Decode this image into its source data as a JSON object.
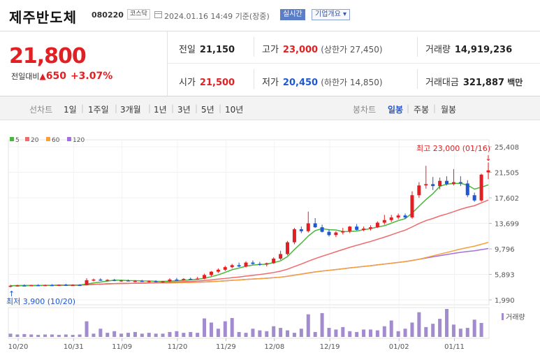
{
  "header": {
    "name": "제주반도체",
    "code": "080220",
    "market": "코스닥",
    "datetime": "2024.01.16 14:49",
    "basis": "기준(장중)",
    "realtime": "실시간",
    "company_info": "기업개요"
  },
  "price": {
    "current": "21,800",
    "change_label": "전일대비",
    "change_arrow": "▲",
    "change": "650",
    "change_pct": "+3.07%"
  },
  "stats": {
    "prev_close": {
      "label": "전일",
      "value": "21,150"
    },
    "high": {
      "label": "고가",
      "value": "23,000",
      "note": "(상한가 27,450)"
    },
    "volume": {
      "label": "거래량",
      "value": "14,919,236"
    },
    "open": {
      "label": "시가",
      "value": "21,500"
    },
    "low": {
      "label": "저가",
      "value": "20,450",
      "note": "(하한가 14,850)"
    },
    "amount": {
      "label": "거래대금",
      "value": "321,887",
      "unit": "백만"
    }
  },
  "period_bar": {
    "line_label": "선차트",
    "line_options": [
      "1일",
      "1주일",
      "3개월",
      "1년",
      "3년",
      "5년",
      "10년"
    ],
    "candle_label": "봉차트",
    "candle_options": [
      "일봉",
      "주봉",
      "월봉"
    ],
    "active_candle": "일봉"
  },
  "colors": {
    "up": "#e22023",
    "down": "#1f57d1",
    "ma5": "#46b83a",
    "ma20": "#ef6a6a",
    "ma60": "#f5a03a",
    "ma120": "#a56ee0",
    "volume": "#a38bcf"
  },
  "chart_data": {
    "type": "candlestick",
    "legend": [
      {
        "name": "5",
        "color": "#46b83a"
      },
      {
        "name": "20",
        "color": "#ef6a6a"
      },
      {
        "name": "60",
        "color": "#f5a03a"
      },
      {
        "name": "120",
        "color": "#a56ee0"
      }
    ],
    "y_ticks": [
      "25,408",
      "21,505",
      "17,602",
      "13,699",
      "9,796",
      "5,893",
      "1,990"
    ],
    "y_range": [
      1990,
      25408
    ],
    "x_ticks": [
      "10/20",
      "10/31",
      "11/09",
      "11/20",
      "11/29",
      "12/08",
      "12/19",
      "01/02",
      "01/11"
    ],
    "high_annotation": "최고 23,000 (01/16)",
    "low_annotation": "최저 3,900 (10/20)",
    "volume_label": "거래량",
    "candles": [
      {
        "o": 4000,
        "h": 4300,
        "l": 3900,
        "c": 4150
      },
      {
        "o": 4150,
        "h": 4300,
        "l": 4050,
        "c": 4200
      },
      {
        "o": 4200,
        "h": 4350,
        "l": 4100,
        "c": 4180
      },
      {
        "o": 4180,
        "h": 4300,
        "l": 4100,
        "c": 4250
      },
      {
        "o": 4250,
        "h": 4380,
        "l": 4150,
        "c": 4200
      },
      {
        "o": 4200,
        "h": 4320,
        "l": 4120,
        "c": 4260
      },
      {
        "o": 4260,
        "h": 4400,
        "l": 4180,
        "c": 4220
      },
      {
        "o": 4220,
        "h": 4350,
        "l": 4150,
        "c": 4300
      },
      {
        "o": 4300,
        "h": 4450,
        "l": 4200,
        "c": 4250
      },
      {
        "o": 4250,
        "h": 4380,
        "l": 4180,
        "c": 4280
      },
      {
        "o": 4280,
        "h": 4400,
        "l": 4200,
        "c": 4260
      },
      {
        "o": 4250,
        "h": 5300,
        "l": 4200,
        "c": 5000
      },
      {
        "o": 5000,
        "h": 5250,
        "l": 4800,
        "c": 5100
      },
      {
        "o": 5100,
        "h": 5300,
        "l": 4900,
        "c": 4950
      },
      {
        "o": 4950,
        "h": 5150,
        "l": 4800,
        "c": 5050
      },
      {
        "o": 5050,
        "h": 5200,
        "l": 4850,
        "c": 4900
      },
      {
        "o": 4900,
        "h": 5050,
        "l": 4750,
        "c": 4980
      },
      {
        "o": 4980,
        "h": 5100,
        "l": 4800,
        "c": 4850
      },
      {
        "o": 4850,
        "h": 5000,
        "l": 4700,
        "c": 4900
      },
      {
        "o": 4900,
        "h": 5050,
        "l": 4750,
        "c": 4800
      },
      {
        "o": 4800,
        "h": 4950,
        "l": 4650,
        "c": 4880
      },
      {
        "o": 4880,
        "h": 5000,
        "l": 4700,
        "c": 4750
      },
      {
        "o": 4750,
        "h": 4900,
        "l": 4600,
        "c": 4820
      },
      {
        "o": 4820,
        "h": 5300,
        "l": 4700,
        "c": 5100
      },
      {
        "o": 5100,
        "h": 5350,
        "l": 4950,
        "c": 5050
      },
      {
        "o": 5050,
        "h": 5300,
        "l": 4950,
        "c": 5200
      },
      {
        "o": 5200,
        "h": 5400,
        "l": 5050,
        "c": 5150
      },
      {
        "o": 5150,
        "h": 5500,
        "l": 5050,
        "c": 5250
      },
      {
        "o": 5250,
        "h": 6000,
        "l": 5150,
        "c": 5800
      },
      {
        "o": 5800,
        "h": 6400,
        "l": 5600,
        "c": 6300
      },
      {
        "o": 6300,
        "h": 6800,
        "l": 6100,
        "c": 6600
      },
      {
        "o": 6600,
        "h": 7200,
        "l": 6400,
        "c": 7000
      },
      {
        "o": 7000,
        "h": 7500,
        "l": 6800,
        "c": 7300
      },
      {
        "o": 7300,
        "h": 7700,
        "l": 7000,
        "c": 7100
      },
      {
        "o": 7100,
        "h": 7900,
        "l": 6950,
        "c": 7700
      },
      {
        "o": 7700,
        "h": 8000,
        "l": 7400,
        "c": 7500
      },
      {
        "o": 7500,
        "h": 7800,
        "l": 7200,
        "c": 7400
      },
      {
        "o": 7400,
        "h": 7700,
        "l": 7100,
        "c": 7600
      },
      {
        "o": 7600,
        "h": 8500,
        "l": 7500,
        "c": 8300
      },
      {
        "o": 8300,
        "h": 9500,
        "l": 8100,
        "c": 9000
      },
      {
        "o": 9000,
        "h": 11000,
        "l": 8800,
        "c": 10800
      },
      {
        "o": 10800,
        "h": 13000,
        "l": 10500,
        "c": 12800
      },
      {
        "o": 12800,
        "h": 13200,
        "l": 12200,
        "c": 12500
      },
      {
        "o": 12500,
        "h": 15500,
        "l": 12300,
        "c": 13700
      },
      {
        "o": 13700,
        "h": 14500,
        "l": 13000,
        "c": 13100
      },
      {
        "o": 13100,
        "h": 13500,
        "l": 12300,
        "c": 12400
      },
      {
        "o": 12400,
        "h": 12800,
        "l": 11700,
        "c": 11900
      },
      {
        "o": 11900,
        "h": 12500,
        "l": 11600,
        "c": 12300
      },
      {
        "o": 12300,
        "h": 13000,
        "l": 12000,
        "c": 12500
      },
      {
        "o": 12500,
        "h": 13300,
        "l": 12200,
        "c": 13200
      },
      {
        "o": 13200,
        "h": 13600,
        "l": 12600,
        "c": 12700
      },
      {
        "o": 12700,
        "h": 13200,
        "l": 12500,
        "c": 12900
      },
      {
        "o": 12900,
        "h": 13400,
        "l": 12600,
        "c": 13100
      },
      {
        "o": 13100,
        "h": 14000,
        "l": 13000,
        "c": 13800
      },
      {
        "o": 13800,
        "h": 15000,
        "l": 13500,
        "c": 14200
      },
      {
        "o": 14200,
        "h": 15000,
        "l": 13900,
        "c": 14600
      },
      {
        "o": 14600,
        "h": 15200,
        "l": 14300,
        "c": 14900
      },
      {
        "o": 14900,
        "h": 15200,
        "l": 14400,
        "c": 14600
      },
      {
        "o": 14600,
        "h": 18600,
        "l": 14400,
        "c": 18000
      },
      {
        "o": 18000,
        "h": 20000,
        "l": 17600,
        "c": 19500
      },
      {
        "o": 19500,
        "h": 22500,
        "l": 19000,
        "c": 19700
      },
      {
        "o": 19700,
        "h": 20800,
        "l": 18800,
        "c": 19400
      },
      {
        "o": 19400,
        "h": 20700,
        "l": 18900,
        "c": 20200
      },
      {
        "o": 20200,
        "h": 20900,
        "l": 19500,
        "c": 19700
      },
      {
        "o": 19700,
        "h": 22000,
        "l": 19500,
        "c": 20000
      },
      {
        "o": 20000,
        "h": 20900,
        "l": 19400,
        "c": 19800
      },
      {
        "o": 19800,
        "h": 20300,
        "l": 17700,
        "c": 18000
      },
      {
        "o": 18000,
        "h": 18400,
        "l": 17000,
        "c": 17200
      },
      {
        "o": 17200,
        "h": 21300,
        "l": 17000,
        "c": 21150
      },
      {
        "o": 21500,
        "h": 23000,
        "l": 20450,
        "c": 21800
      }
    ],
    "volumes": [
      8,
      6,
      7,
      6,
      5,
      6,
      6,
      5,
      6,
      5,
      6,
      38,
      8,
      20,
      10,
      14,
      8,
      10,
      12,
      8,
      10,
      8,
      8,
      12,
      14,
      10,
      12,
      10,
      45,
      35,
      20,
      38,
      46,
      12,
      10,
      20,
      16,
      14,
      26,
      22,
      16,
      10,
      20,
      55,
      12,
      58,
      22,
      18,
      24,
      14,
      12,
      18,
      18,
      16,
      26,
      40,
      14,
      20,
      35,
      60,
      24,
      32,
      44,
      68,
      30,
      20,
      22,
      42,
      34
    ]
  }
}
